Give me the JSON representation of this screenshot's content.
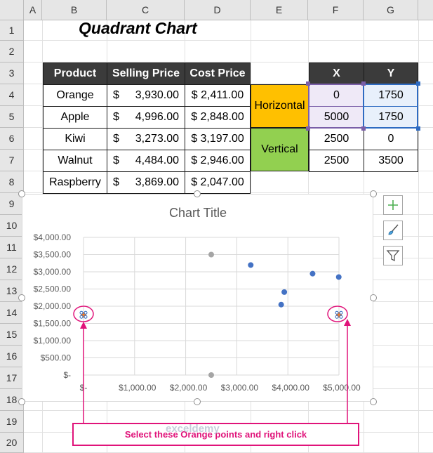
{
  "sheet_title": "Quadrant Chart",
  "columns": [
    "A",
    "B",
    "C",
    "D",
    "E",
    "F",
    "G"
  ],
  "rows": [
    "1",
    "2",
    "3",
    "4",
    "5",
    "6",
    "7",
    "8",
    "9",
    "10",
    "11",
    "12",
    "13",
    "14",
    "15",
    "16",
    "17",
    "18",
    "19",
    "20"
  ],
  "product_table": {
    "headers": [
      "Product",
      "Selling Price",
      "Cost Price"
    ],
    "rows": [
      {
        "product": "Orange",
        "sell_sym": "$",
        "sell": "3,930.00",
        "cost": "$ 2,411.00"
      },
      {
        "product": "Apple",
        "sell_sym": "$",
        "sell": "4,996.00",
        "cost": "$ 2,848.00"
      },
      {
        "product": "Kiwi",
        "sell_sym": "$",
        "sell": "3,273.00",
        "cost": "$ 3,197.00"
      },
      {
        "product": "Walnut",
        "sell_sym": "$",
        "sell": "4,484.00",
        "cost": "$ 2,946.00"
      },
      {
        "product": "Raspberry",
        "sell_sym": "$",
        "sell": "3,869.00",
        "cost": "$ 2,047.00"
      }
    ]
  },
  "xy_table": {
    "headers": [
      "X",
      "Y"
    ],
    "horizontal_label": "Horizontal",
    "vertical_label": "Vertical",
    "rows": [
      [
        "0",
        "1750"
      ],
      [
        "5000",
        "1750"
      ],
      [
        "2500",
        "0"
      ],
      [
        "2500",
        "3500"
      ]
    ]
  },
  "chart_data": {
    "type": "scatter",
    "title": "Chart Title",
    "xlim": [
      0,
      5000
    ],
    "ylim": [
      0,
      4000
    ],
    "x_ticks": [
      "$-",
      "$1,000.00",
      "$2,000.00",
      "$3,000.00",
      "$4,000.00",
      "$5,000.00"
    ],
    "y_ticks": [
      "$-",
      "$500.00",
      "$1,000.00",
      "$1,500.00",
      "$2,000.00",
      "$2,500.00",
      "$3,000.00",
      "$3,500.00",
      "$4,000.00"
    ],
    "grid": true,
    "series": [
      {
        "color": "#4472c4",
        "points": [
          [
            3930,
            2411
          ],
          [
            4996,
            2848
          ],
          [
            3273,
            3197
          ],
          [
            4484,
            2946
          ],
          [
            3869,
            2047
          ]
        ]
      },
      {
        "color": "#ed7d31",
        "points": [
          [
            0,
            1750
          ],
          [
            5000,
            1750
          ]
        ]
      },
      {
        "color": "#a5a5a5",
        "points": [
          [
            2500,
            0
          ],
          [
            2500,
            3500
          ]
        ]
      }
    ]
  },
  "annotation": "Select these Orange points and right click",
  "watermark": "exceldemy",
  "colors": {
    "highlight": "#e0137a",
    "horizontal": "#ffc000",
    "vertical": "#92d050",
    "header": "#3b3b3b"
  },
  "side_buttons": [
    "plus-icon",
    "brush-icon",
    "filter-icon"
  ]
}
